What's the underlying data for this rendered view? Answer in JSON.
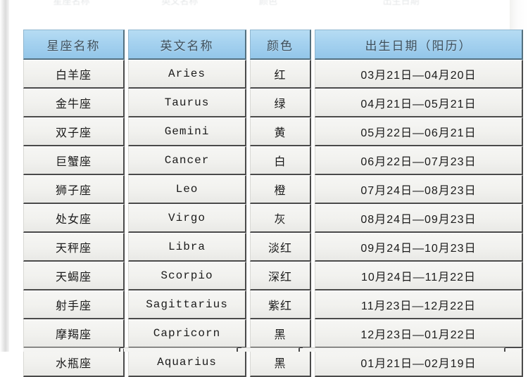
{
  "page": {
    "ghost_fragments": [
      "星座名称",
      "英文名称",
      "颜色",
      "出生日期"
    ]
  },
  "table": {
    "name": "zodiac-sign-table",
    "columns": [
      {
        "key": "name",
        "label": "星座名称"
      },
      {
        "key": "en",
        "label": "英文名称"
      },
      {
        "key": "color",
        "label": "颜色"
      },
      {
        "key": "date",
        "label": "出生日期（阳历）"
      }
    ],
    "rows": [
      {
        "name": "白羊座",
        "en": "Aries",
        "color": "红",
        "date": "03月21日—04月20日"
      },
      {
        "name": "金牛座",
        "en": "Taurus",
        "color": "绿",
        "date": "04月21日—05月21日"
      },
      {
        "name": "双子座",
        "en": "Gemini",
        "color": "黄",
        "date": "05月22日—06月21日"
      },
      {
        "name": "巨蟹座",
        "en": "Cancer",
        "color": "白",
        "date": "06月22日—07月23日"
      },
      {
        "name": "狮子座",
        "en": "Leo",
        "color": "橙",
        "date": "07月24日—08月23日"
      },
      {
        "name": "处女座",
        "en": "Virgo",
        "color": "灰",
        "date": "08月24日—09月23日"
      },
      {
        "name": "天秤座",
        "en": "Libra",
        "color": "淡红",
        "date": "09月24日—10月23日"
      },
      {
        "name": "天蝎座",
        "en": "Scorpio",
        "color": "深红",
        "date": "10月24日—11月22日"
      },
      {
        "name": "射手座",
        "en": "Sagittarius",
        "color": "紫红",
        "date": "11月23日—12月22日"
      },
      {
        "name": "摩羯座",
        "en": "Capricorn",
        "color": "黑",
        "date": "12月23日—01月22日"
      },
      {
        "name": "水瓶座",
        "en": "Aquarius",
        "color": "黑",
        "date": "01月21日—02月19日"
      }
    ]
  },
  "colors": {
    "header_fill": "#a4d1ef",
    "header_text": "#3d4f5c",
    "cell_fill": "#f1f1ee",
    "cell_text": "#1a1a1a",
    "cell_border": "#4a4a4a"
  }
}
